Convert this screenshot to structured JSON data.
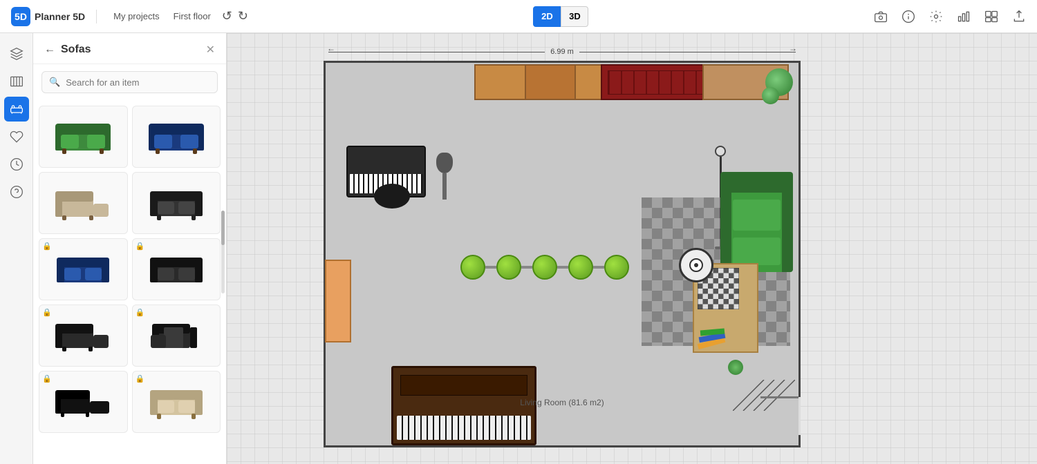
{
  "app": {
    "title": "Planner 5D",
    "logo_text": "5D"
  },
  "navbar": {
    "my_projects": "My projects",
    "first_floor": "First floor",
    "view_2d": "2D",
    "view_3d": "3D"
  },
  "panel": {
    "back_label": "Sofas",
    "search_placeholder": "Search for an item",
    "items": [
      {
        "id": 1,
        "locked": false,
        "color": "green",
        "label": "Green Sofa"
      },
      {
        "id": 2,
        "locked": false,
        "color": "navy",
        "label": "Navy Sofa"
      },
      {
        "id": 3,
        "locked": false,
        "color": "beige-chaise",
        "label": "Beige Chaise Sofa"
      },
      {
        "id": 4,
        "locked": false,
        "color": "dark-sofa",
        "label": "Dark Sofa"
      },
      {
        "id": 5,
        "locked": true,
        "color": "navy-small",
        "label": "Navy Small Sofa"
      },
      {
        "id": 6,
        "locked": true,
        "color": "dark-small",
        "label": "Dark Small Sofa"
      },
      {
        "id": 7,
        "locked": true,
        "color": "dark-chaise",
        "label": "Dark Chaise Sofa"
      },
      {
        "id": 8,
        "locked": true,
        "color": "dark-chaise2",
        "label": "Dark Chaise Sofa 2"
      },
      {
        "id": 9,
        "locked": true,
        "color": "black-chaise",
        "label": "Black Chaise Sofa"
      },
      {
        "id": 10,
        "locked": true,
        "color": "beige-sofa",
        "label": "Beige Sofa"
      }
    ]
  },
  "tools": [
    {
      "id": "3d-view",
      "icon": "cube",
      "label": "3D View"
    },
    {
      "id": "walls",
      "icon": "walls",
      "label": "Walls"
    },
    {
      "id": "items",
      "icon": "sofa",
      "label": "Items",
      "active": true
    },
    {
      "id": "favorites",
      "icon": "heart",
      "label": "Favorites"
    },
    {
      "id": "history",
      "icon": "clock",
      "label": "History"
    },
    {
      "id": "settings",
      "icon": "help",
      "label": "Help"
    }
  ],
  "canvas": {
    "measurement": "6.99 m",
    "room_label": "Living Room (81.6 m2)"
  },
  "icons": {
    "camera": "📷",
    "info": "ℹ",
    "settings": "⚙",
    "stats": "📊",
    "share": "⤴",
    "export": "↗"
  }
}
